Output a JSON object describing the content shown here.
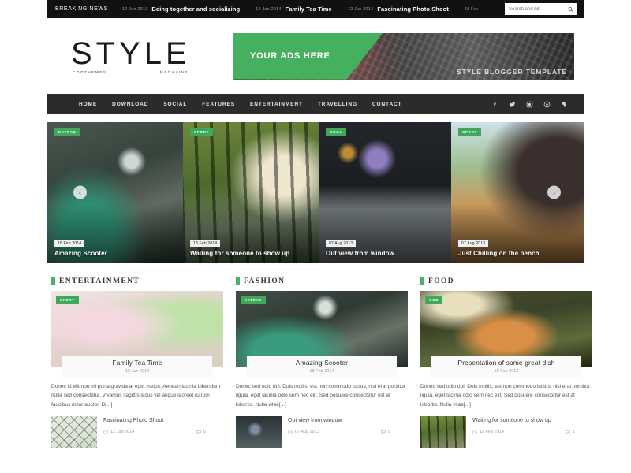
{
  "topbar": {
    "breaking_label": "BREAKING NEWS",
    "ticker": [
      {
        "date": "12 Jun 2013",
        "title": "Being together and socializing"
      },
      {
        "date": "12 Jun 2014",
        "title": "Family Tea Time"
      },
      {
        "date": "12 Jun 2014",
        "title": "Fascinating Photo Shoot"
      }
    ],
    "tail_date": "18 Feb",
    "search_placeholder": "Search and hit",
    "search_value": ""
  },
  "logo": {
    "main": "STYLE",
    "left": "COOTHEMES",
    "right": "MAGAZINE"
  },
  "ad": {
    "label": "YOUR ADS HERE",
    "caption": "STYLE BLOGGER TEMPLATE"
  },
  "nav": {
    "items": [
      "HOME",
      "DOWNLOAD",
      "SOCIAL",
      "FEATURES",
      "ENTERTAINMENT",
      "TRAVELLING",
      "CONTACT"
    ],
    "social": [
      "facebook-icon",
      "twitter-icon",
      "instagram-icon",
      "dribbble-icon",
      "youtube-icon"
    ]
  },
  "slider": {
    "prev": "‹",
    "next": "›",
    "slides": [
      {
        "badge": "EXTRAS",
        "date": "18 Feb 2014",
        "title": "Amazing Scooter"
      },
      {
        "badge": "SPORT",
        "date": "18 Feb 2014",
        "title": "Waiting for someone to show up"
      },
      {
        "badge": "COOL",
        "date": "07 Aug 2013",
        "title": "Out view from window"
      },
      {
        "badge": "SPORT",
        "date": "07 Aug 2013",
        "title": "Just Chilling on the bench"
      }
    ]
  },
  "columns": [
    {
      "category": "ENTERTAINMENT",
      "card": {
        "badge": "SPORT",
        "title": "Family Tea Time",
        "date": "12 Jun 2014",
        "excerpt": "Donec id elit non mi porta gravida at eget metus. Aenean lacinia bibendum nulla sed consectetur. Vivamus sagittis lacus vel augue laoreet rutrum faucibus dolor auctor. D[...]"
      },
      "mini": {
        "title": "Fascinating Photo Shoot",
        "date": "12 Jun 2014",
        "comments": "0"
      }
    },
    {
      "category": "FASHION",
      "card": {
        "badge": "EXTRAS",
        "title": "Amazing Scooter",
        "date": "18 Feb 2014",
        "excerpt": "Donec sed odio dui. Duis mollis, est non commodo luctus, nisi erat porttitor ligula, eget lacinia odio sem nec elit. Sed posuere consectetur est at lobortis. Nulla vitae[...]"
      },
      "mini": {
        "title": "Out view from window",
        "date": "07 Aug 2013",
        "comments": "0"
      }
    },
    {
      "category": "FOOD",
      "card": {
        "badge": "GOD",
        "title": "Presentation of some great dish",
        "date": "18 Feb 2014",
        "excerpt": "Donec sed odio dui. Duis mollis, est non commodo luctus, nisi erat porttitor ligula, eget lacinia odio sem nec elit. Sed posuere consectetur est at lobortis. Nulla vitae[...]"
      },
      "mini": {
        "title": "Waiting for someone to show up",
        "date": "18 Feb 2014",
        "comments": "1"
      }
    }
  ],
  "colors": {
    "accent": "#45b05e",
    "badge": "#3fa85a",
    "topbar_bg": "#111111",
    "nav_bg": "#2b2b2b"
  }
}
